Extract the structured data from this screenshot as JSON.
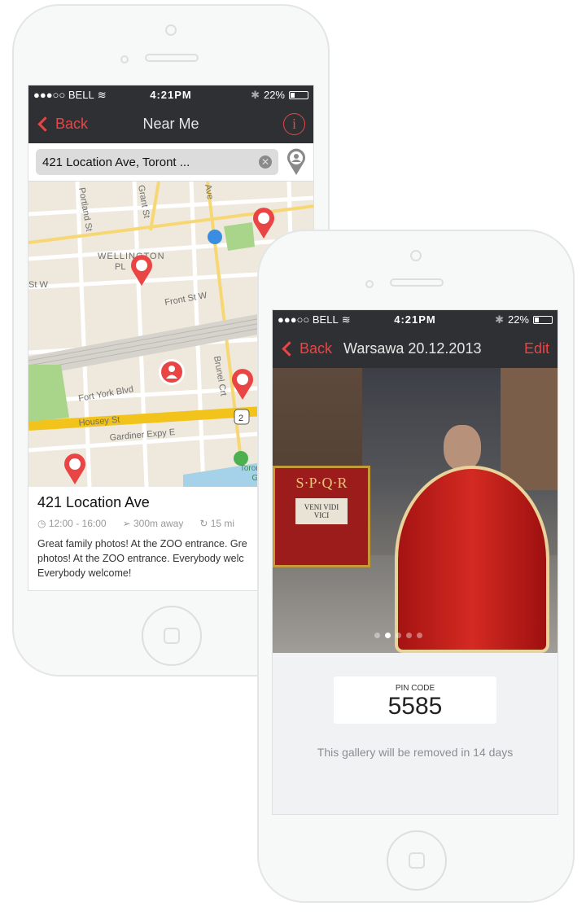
{
  "phone1": {
    "status": {
      "carrier": "●●●○○ BELL",
      "time": "4:21PM",
      "battery": "22%"
    },
    "nav": {
      "back": "Back",
      "title": "Near Me",
      "info_icon": "info-icon"
    },
    "search": {
      "value": "421 Location Ave, Toront ..."
    },
    "map": {
      "labels": [
        "Portland St",
        "Grant St",
        "Ave",
        "WELLINGTON PL",
        "St W",
        "Front St W",
        "Fort York Blvd",
        "Housey St",
        "Gardiner Expy E",
        "Brunel Crt",
        "Toronto Music Garden",
        "Tor",
        "St",
        "k",
        "2"
      ]
    },
    "place": {
      "title": "421 Location Ave",
      "hours": "12:00 - 16:00",
      "distance": "300m away",
      "duration": "15 mi",
      "description": [
        "Great family photos! At the ZOO entrance. Gre",
        "photos! At the ZOO entrance. Everybody welc",
        "Everybody welcome!"
      ]
    }
  },
  "phone2": {
    "status": {
      "carrier": "●●●○○ BELL",
      "time": "4:21PM",
      "battery": "22%"
    },
    "nav": {
      "back": "Back",
      "title": "Warsawa 20.12.2013",
      "edit": "Edit"
    },
    "photo": {
      "banner_text": "S·P·Q·R",
      "plaque": "VENI VIDI VICI",
      "pages": 5,
      "active_page": 1
    },
    "pin": {
      "label": "PIN CODE",
      "value": "5585"
    },
    "notice": "This gallery will be removed in 14 days"
  },
  "colors": {
    "accent": "#e94545",
    "bar": "#2f3033"
  }
}
